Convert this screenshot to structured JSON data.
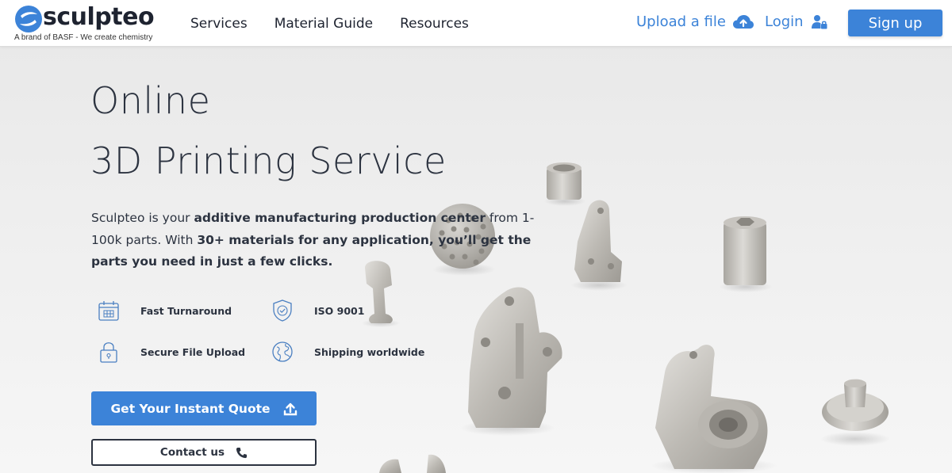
{
  "header": {
    "logo_text": "sculpteo",
    "logo_tagline": "A brand of BASF - We create chemistry",
    "nav": [
      {
        "label": "Services"
      },
      {
        "label": "Material Guide"
      },
      {
        "label": "Resources"
      }
    ],
    "upload_label": "Upload a file",
    "login_label": "Login",
    "signup_label": "Sign up"
  },
  "hero": {
    "title_line1": "Online",
    "title_line2": "3D Printing Service",
    "description": [
      {
        "text": "Sculpteo is your ",
        "bold": false
      },
      {
        "text": "additive manufacturing production center",
        "bold": true
      },
      {
        "text": " from 1-100k parts. With ",
        "bold": false
      },
      {
        "text": "30+ materials for any application, you’ll get the parts you need in just a few clicks.",
        "bold": true
      }
    ],
    "features": [
      {
        "label": "Fast Turnaround",
        "icon": "calendar-icon"
      },
      {
        "label": "ISO 9001",
        "icon": "shield-check-icon"
      },
      {
        "label": "Secure File Upload",
        "icon": "padlock-icon"
      },
      {
        "label": "Shipping worldwide",
        "icon": "globe-icon"
      }
    ],
    "quote_button": "Get Your Instant Quote",
    "contact_button": "Contact us"
  },
  "colors": {
    "accent": "#3c83d8",
    "text": "#2c3340",
    "icon_blue": "#4a7fc1"
  }
}
